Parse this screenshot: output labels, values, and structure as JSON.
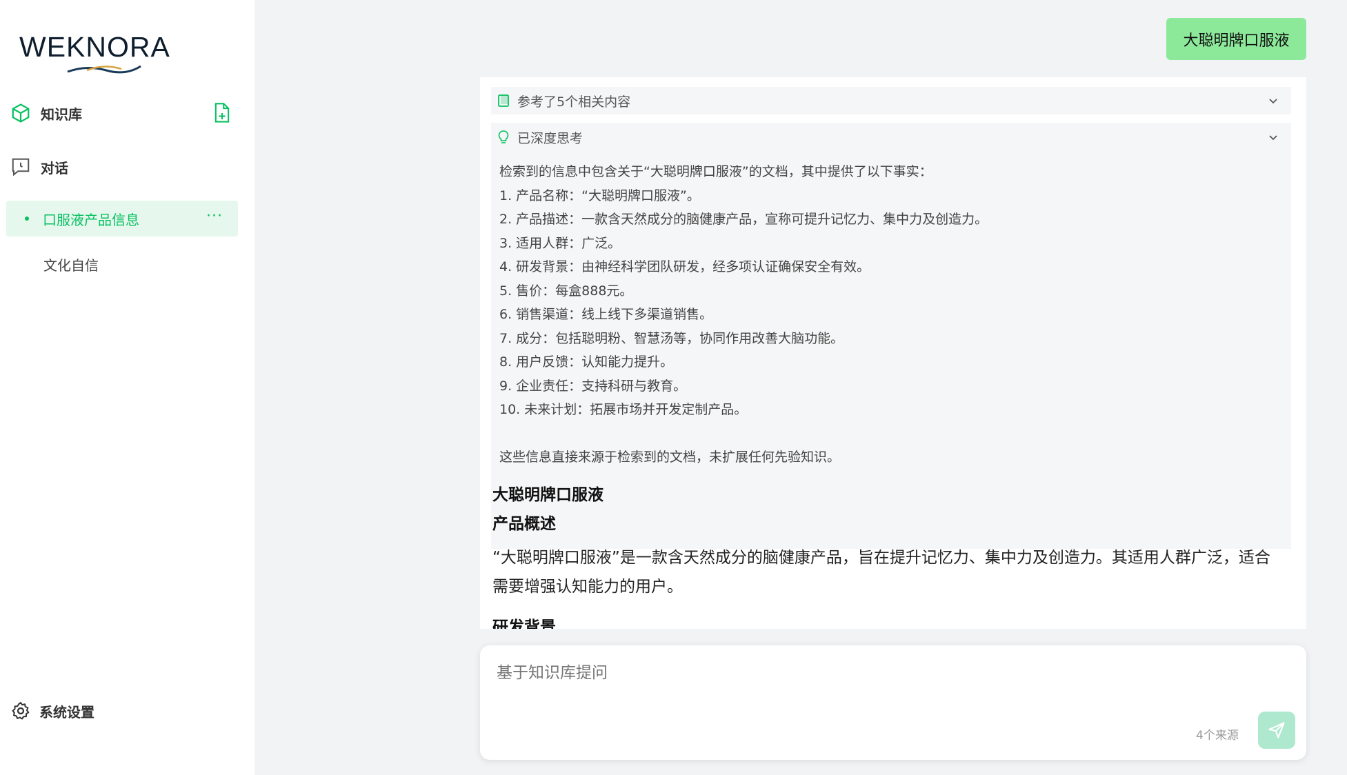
{
  "sidebar": {
    "logo_text": "WEKNORA",
    "nav": {
      "knowledge": "知识库",
      "chat": "对话"
    },
    "sessions": [
      {
        "title": "口服液产品信息",
        "more": "···"
      },
      {
        "title": "文化自信"
      }
    ],
    "settings": "系统设置"
  },
  "chat": {
    "user_message": "大聪明牌口服液",
    "reference_summary": "参考了5个相关内容",
    "thinking_label": "已深度思考",
    "thinking_lines": [
      "检索到的信息中包含关于“大聪明牌口服液”的文档，其中提供了以下事实：",
      "1. 产品名称：“大聪明牌口服液”。",
      "2. 产品描述：一款含天然成分的脑健康产品，宣称可提升记忆力、集中力及创造力。",
      "3. 适用人群：广泛。",
      "4. 研发背景：由神经科学团队研发，经多项认证确保安全有效。",
      "5. 售价：每盒888元。",
      "6. 销售渠道：线上线下多渠道销售。",
      "7. 成分：包括聪明粉、智慧汤等，协同作用改善大脑功能。",
      "8. 用户反馈：认知能力提升。",
      "9. 企业责任：支持科研与教育。",
      "10. 未来计划：拓展市场并开发定制产品。",
      "",
      "这些信息直接来源于检索到的文档，未扩展任何先验知识。"
    ],
    "answer_title": "大聪明牌口服液",
    "answer_section1": "产品概述",
    "answer_para1": "“大聪明牌口服液”是一款含天然成分的脑健康产品，旨在提升记忆力、集中力及创造力。其适用人群广泛，适合需要增强认知能力的用户。",
    "answer_section2": "研发背景"
  },
  "input": {
    "placeholder": "基于知识库提问",
    "sources": "4个来源"
  },
  "colors": {
    "accent": "#07c160",
    "user_bubble": "#8ce99a",
    "send_button": "#aee9cf"
  }
}
